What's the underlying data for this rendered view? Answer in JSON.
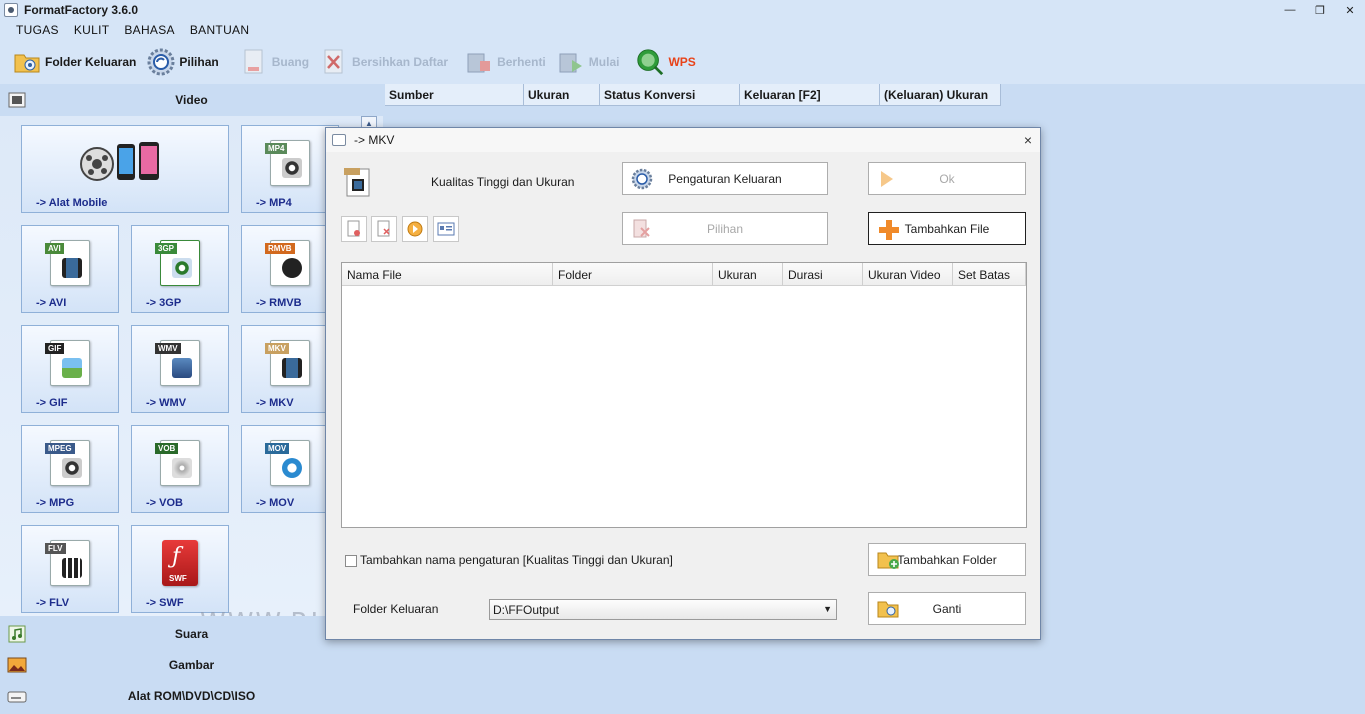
{
  "window": {
    "title": "FormatFactory 3.6.0",
    "btn_min": "—",
    "btn_restore": "❐",
    "btn_close": "✕"
  },
  "menu": [
    "TUGAS",
    "KULIT",
    "BAHASA",
    "BANTUAN"
  ],
  "toolbar": {
    "folder_output": "Folder Keluaran",
    "options": "Pilihan",
    "remove": "Buang",
    "clear_list": "Bersihkan Daftar",
    "stop": "Berhenti",
    "start": "Mulai",
    "wps": "WPS"
  },
  "left": {
    "video_section": "Video",
    "tiles": {
      "mobile": "-> Alat Mobile",
      "mp4": "-> MP4",
      "avi": "-> AVI",
      "g3p": "-> 3GP",
      "rmvb": "-> RMVB",
      "gif": "-> GIF",
      "wmv": "-> WMV",
      "mkv": "-> MKV",
      "mpg": "-> MPG",
      "vob": "-> VOB",
      "mov": "-> MOV",
      "flv": "-> FLV",
      "swf": "-> SWF"
    },
    "tags": {
      "mp4": "MP4",
      "avi": "AVI",
      "g3p": "3GP",
      "rmvb": "RMVB",
      "gif": "GIF",
      "wmv": "WMV",
      "mkv": "MKV",
      "mpg": "MPEG",
      "vob": "VOB",
      "mov": "MOV",
      "flv": "FLV",
      "swf": "SWF"
    },
    "audio_section": "Suara",
    "image_section": "Gambar",
    "rom_section": "Alat ROM\\DVD\\CD\\ISO"
  },
  "watermark": "WWW.RIALSOFT.COM",
  "list_columns": [
    "Sumber",
    "Ukuran",
    "Status Konversi",
    "Keluaran [F2]",
    "(Keluaran) Ukuran"
  ],
  "dialog": {
    "title": "-> MKV",
    "close": "×",
    "quality": "Kualitas Tinggi dan Ukuran",
    "output_settings": "Pengaturan Keluaran",
    "ok": "Ok",
    "options": "Pilihan",
    "add_file": "Tambahkan File",
    "columns": [
      "Nama File",
      "Folder",
      "Ukuran",
      "Durasi",
      "Ukuran Video",
      "Set Batas"
    ],
    "add_setting_name": "Tambahkan nama pengaturan [Kualitas Tinggi dan Ukuran]",
    "add_folder": "Tambahkan Folder",
    "output_folder_label": "Folder Keluaran",
    "output_folder_value": "D:\\FFOutput",
    "change": "Ganti"
  }
}
